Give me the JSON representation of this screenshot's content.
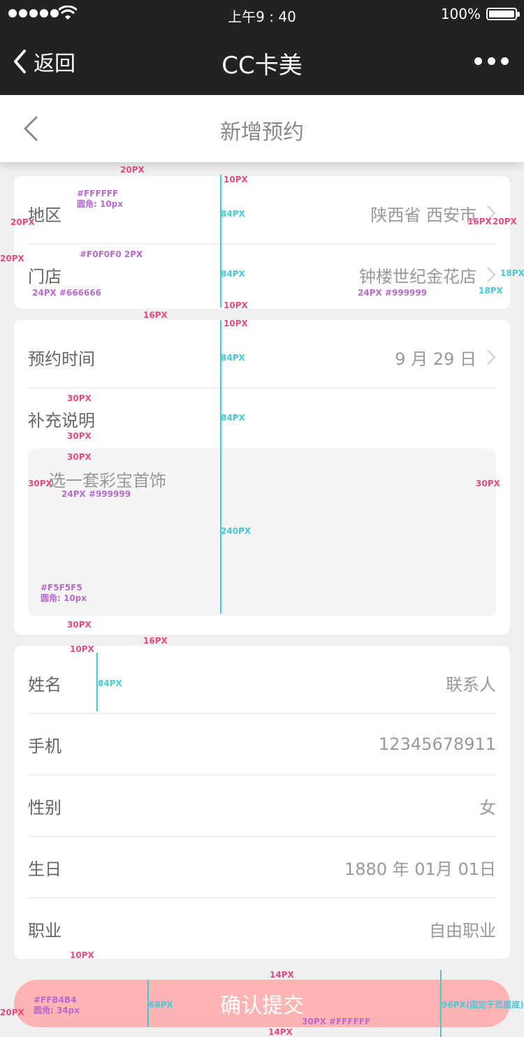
{
  "status_bar": {
    "time": "上午9 : 40",
    "battery": "100%"
  },
  "nav": {
    "back_label": "返回",
    "title": "CC卡美"
  },
  "header": {
    "title": "新增预约"
  },
  "store_card": {
    "rows": [
      {
        "label": "地区",
        "value": "陕西省 西安市"
      },
      {
        "label": "门店",
        "value": "钟楼世纪金花店"
      }
    ]
  },
  "booking_card": {
    "time_label": "预约时间",
    "time_value": "9 月 29 日",
    "note_label": "补充说明",
    "note_placeholder": "选一套彩宝首饰"
  },
  "contact_card": {
    "rows": [
      {
        "label": "姓名",
        "value": "联系人"
      },
      {
        "label": "手机",
        "value": "12345678911"
      },
      {
        "label": "性别",
        "value": "女"
      },
      {
        "label": "生日",
        "value": "1880 年 01月 01日"
      },
      {
        "label": "职业",
        "value": "自由职业"
      }
    ]
  },
  "submit_label": "确认提交",
  "annotations": {
    "a1": "20PX",
    "a2": "#FFFFFF",
    "a3": "圆角: 10px",
    "a4": "10PX",
    "a5": "84PX",
    "a6": "20PX",
    "a7": "16PX",
    "a8": "20PX",
    "a9": "#F0F0F0  2PX",
    "a10": "20PX",
    "a11": "84PX",
    "a12": "18PX",
    "a13": "24PX  #666666",
    "a14": "24PX  #999999",
    "a15": "18PX",
    "a16": "10PX",
    "a17": "16PX",
    "a18": "10PX",
    "a19": "84PX",
    "a20": "30PX",
    "a21": "84PX",
    "a22": "30PX",
    "a23": "30PX",
    "a24": "30PX",
    "a25": "24PX  #999999",
    "a26": "30PX",
    "a27": "240PX",
    "a28": "#F5F5F5",
    "a29": "圆角: 10px",
    "a30": "30PX",
    "a31": "16PX",
    "a32": "10PX",
    "a33": "84PX",
    "a34": "10PX",
    "a35": "14PX",
    "a36": "#FFB4B4",
    "a37": "圆角: 34px",
    "a38": "68PX",
    "a39": "96PX(固定于页面底)",
    "a40": "20PX",
    "a41": "30PX  #FFFFFF",
    "a42": "14PX"
  },
  "colors": {
    "accent": "#ffb4b4",
    "bar": "#222222",
    "bg": "#f0f0f0",
    "annotation_pink": "#e84a7f",
    "annotation_cyan": "#45c8d8",
    "annotation_purple": "#b76ad0"
  }
}
